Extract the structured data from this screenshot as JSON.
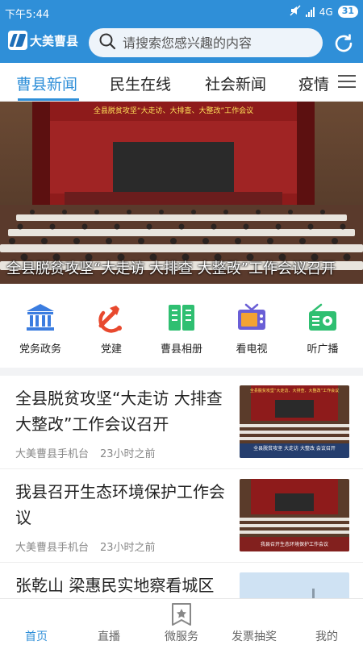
{
  "status": {
    "time": "下午5:44",
    "network": "4G",
    "battery": "31"
  },
  "header": {
    "logo_text": "大美曹县",
    "search_placeholder": "请搜索您感兴趣的内容",
    "accent_color": "#2f8fd8"
  },
  "tabs": [
    {
      "label": "曹县新闻",
      "active": true
    },
    {
      "label": "民生在线",
      "active": false
    },
    {
      "label": "社会新闻",
      "active": false
    },
    {
      "label": "疫情",
      "active": false
    }
  ],
  "banner": {
    "caption": "全县脱贫攻坚“大走访 大排查 大整改”工作会议召开",
    "stage_banner_text": "全县脱贫攻坚“大走访、大排查、大整改”工作会议"
  },
  "categories": [
    {
      "label": "党务政务",
      "icon": "government-building-icon"
    },
    {
      "label": "党建",
      "icon": "party-emblem-icon"
    },
    {
      "label": "曹县相册",
      "icon": "album-book-icon"
    },
    {
      "label": "看电视",
      "icon": "tv-icon"
    },
    {
      "label": "听广播",
      "icon": "radio-icon"
    }
  ],
  "news": [
    {
      "title": "全县脱贫攻坚“大走访 大排查 大整改”工作会议召开",
      "source": "大美曹县手机台",
      "time": "23小时之前",
      "thumb_caption": "全县脱贫攻坚 大走访 大整改 会议召开"
    },
    {
      "title": "我县召开生态环境保护工作会议",
      "source": "大美曹县手机台",
      "time": "23小时之前",
      "thumb_caption": "我县召开生态环境保护工作会议"
    },
    {
      "title": "张乾山 梁惠民实地察看城区",
      "source": "",
      "time": ""
    }
  ],
  "bottom_nav": [
    {
      "label": "首页",
      "active": true
    },
    {
      "label": "直播",
      "active": false
    },
    {
      "label": "微服务",
      "active": false
    },
    {
      "label": "发票抽奖",
      "active": false
    },
    {
      "label": "我的",
      "active": false
    }
  ]
}
